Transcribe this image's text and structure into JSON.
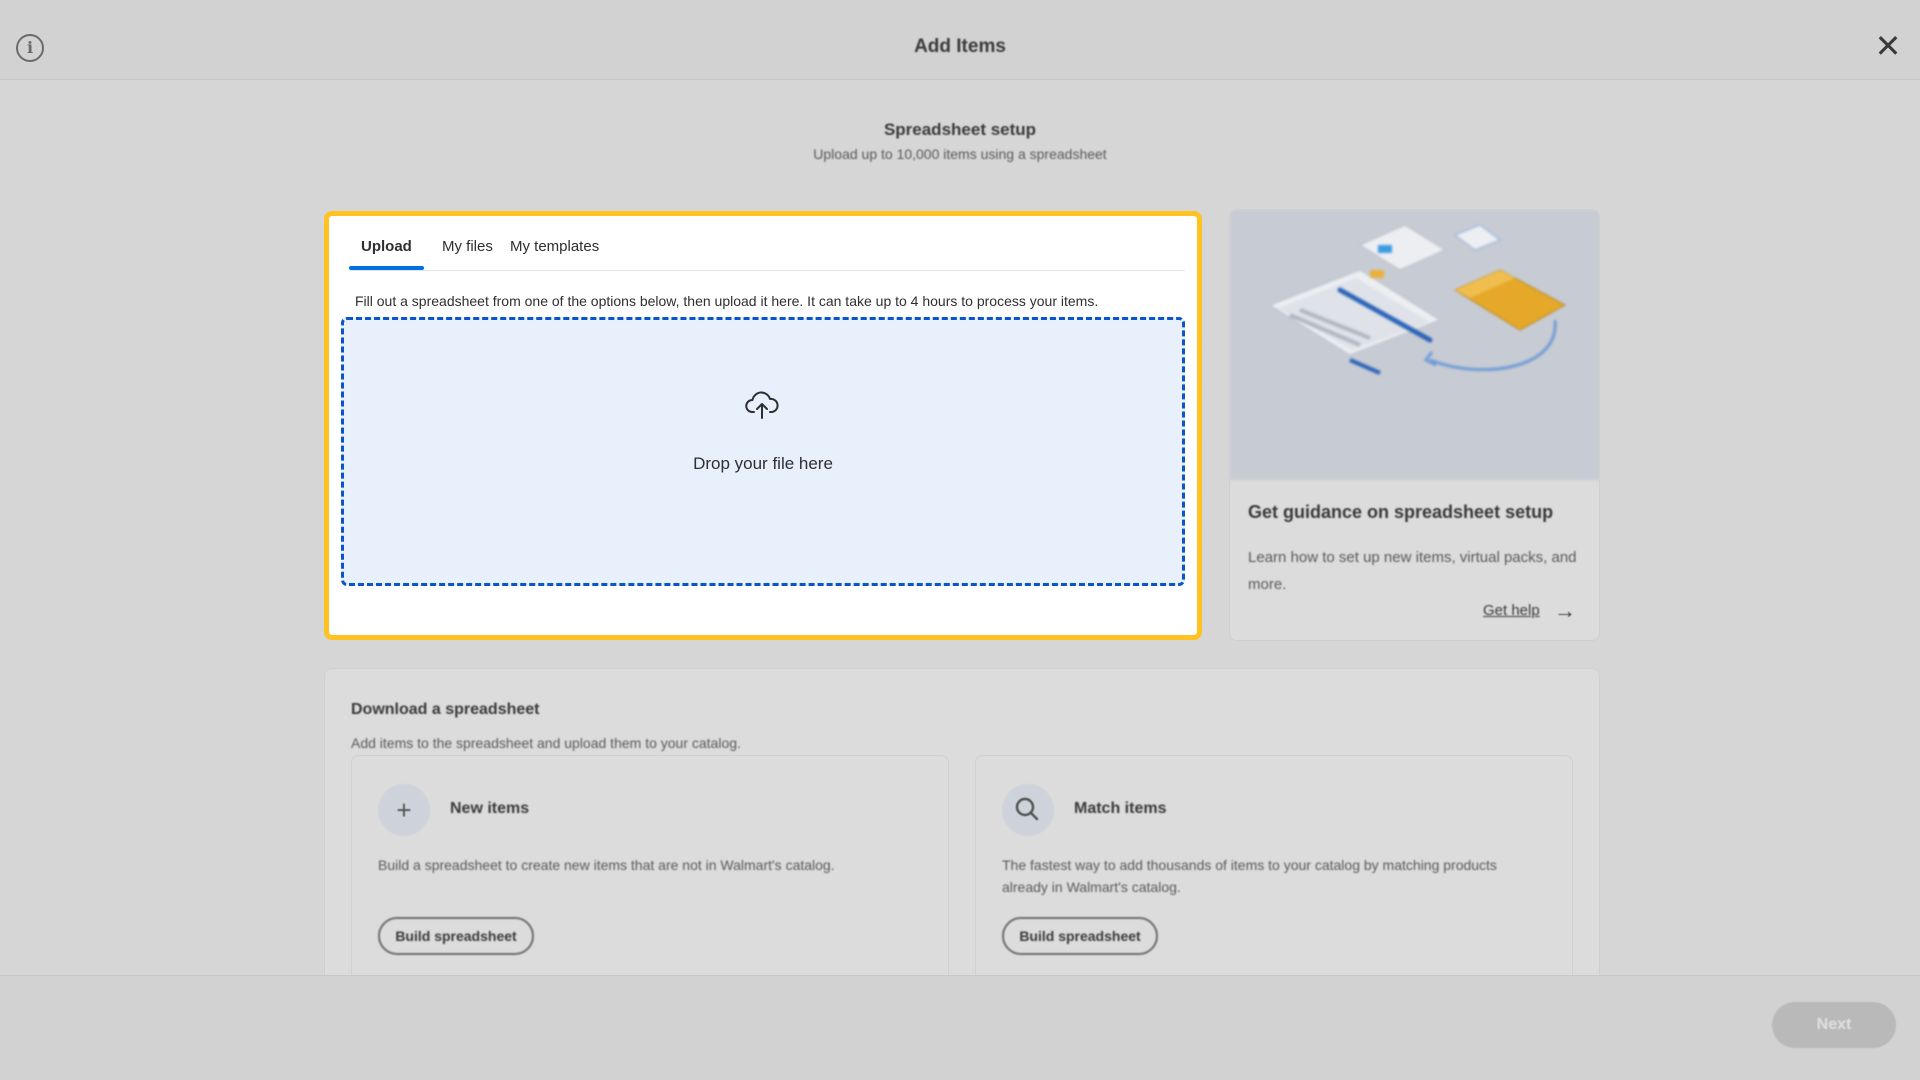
{
  "header": {
    "title": "Add Items",
    "info_icon": "info-icon",
    "close_icon": "close-icon"
  },
  "setup": {
    "title": "Spreadsheet setup",
    "subtitle": "Upload up to 10,000 items using a spreadsheet"
  },
  "upload": {
    "tabs": [
      {
        "label": "Upload",
        "active": true
      },
      {
        "label": "My files",
        "active": false
      },
      {
        "label": "My templates",
        "active": false
      }
    ],
    "description": "Fill out a spreadsheet from one of the options below, then upload it here. It can take up to 4 hours to process your items.",
    "dropzone_label": "Drop your file here",
    "dropzone_icon": "cloud-upload-icon",
    "highlight_color": "#ffc220",
    "accent_color": "#0071dc"
  },
  "guidance": {
    "title": "Get guidance on spreadsheet setup",
    "text": "Learn how to set up new items, virtual packs, and more.",
    "link_label": "Get help",
    "link_icon": "arrow-right-icon"
  },
  "download": {
    "title": "Download a spreadsheet",
    "subtitle": "Add items to the spreadsheet and upload them to your catalog.",
    "options": [
      {
        "icon": "plus-icon",
        "title": "New items",
        "description": "Build a spreadsheet to create new items that are not in Walmart's catalog.",
        "button_label": "Build spreadsheet"
      },
      {
        "icon": "search-icon",
        "title": "Match items",
        "description": "The fastest way to add thousands of items to your catalog by matching products already in Walmart's catalog.",
        "button_label": "Build spreadsheet"
      }
    ]
  },
  "footer": {
    "next_label": "Next"
  }
}
